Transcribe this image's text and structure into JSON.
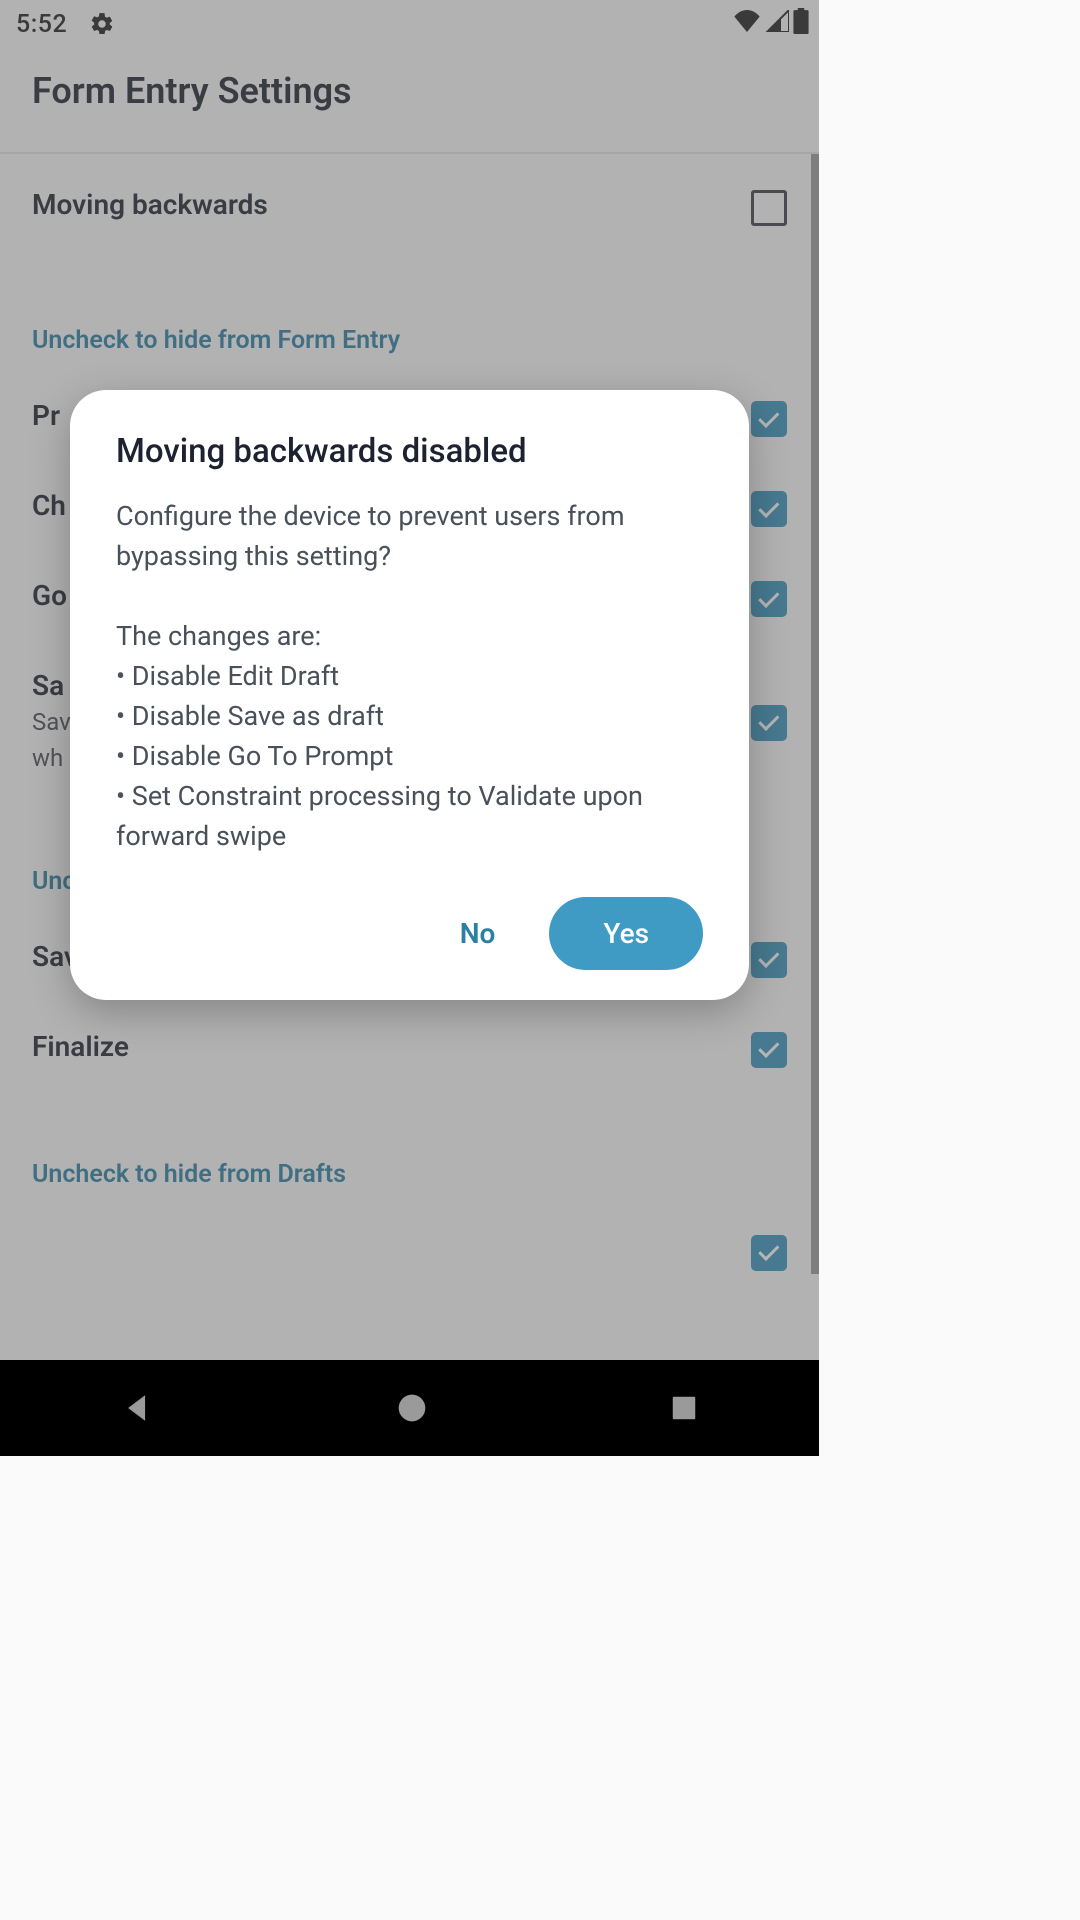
{
  "status": {
    "time": "5:52"
  },
  "header": {
    "title": "Form Entry Settings"
  },
  "settings": {
    "moving_backwards": {
      "label": "Moving backwards",
      "checked": false
    },
    "section_form_entry": "Uncheck to hide from Form Entry",
    "row2": {
      "label": "Pr"
    },
    "row3": {
      "label": "Ch"
    },
    "row4": {
      "label": "Go"
    },
    "row5": {
      "label": "Sa",
      "sub1": "Sav",
      "sub2": "wh"
    },
    "section_unc": "Unc",
    "save_as_draft": {
      "label": "Save as draft",
      "checked": true
    },
    "finalize": {
      "label": "Finalize",
      "checked": true
    },
    "section_drafts": "Uncheck to hide from Drafts"
  },
  "dialog": {
    "title": "Moving backwards disabled",
    "body": "Configure the device to prevent users from bypassing this setting?\n\nThe changes are:\n• Disable Edit Draft\n• Disable Save as draft\n• Disable Go To Prompt\n• Set Constraint processing to Validate upon forward swipe",
    "no": "No",
    "yes": "Yes"
  }
}
